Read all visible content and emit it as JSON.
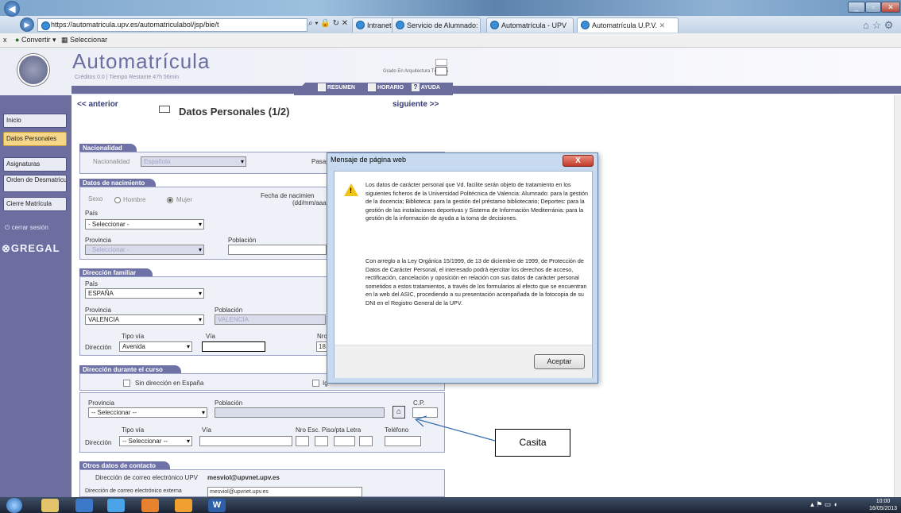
{
  "browser": {
    "address": "https://automatricula.upv.es/automatriculabol/jsp/bie/t",
    "tabs": [
      "Intranet UPV",
      "Servicio de Alumnado: ...",
      "Automatrícula - UPV",
      "Automatrícula U.P.V."
    ],
    "fav_convert": "Convertir",
    "fav_select": "Seleccionar",
    "close_x": "x"
  },
  "app": {
    "title": "Automatrícula",
    "credits": "Créditos 0.0 | Tiempo Restante 47h 56min",
    "degree": "Grado En Arquitectura Técnica",
    "resumen": "RESUMEN",
    "horario": "HORARIO",
    "ayuda": "AYUDA"
  },
  "sidebar": {
    "items": [
      "Inicio",
      "Datos Personales",
      "Asignaturas",
      "Orden de Desmatriculación",
      "Cierre Matrícula"
    ],
    "logout": "cerrar sesión",
    "brand": "GREGAL"
  },
  "page": {
    "prev": "<< anterior",
    "title": "Datos Personales (1/2)",
    "next": "siguiente >>"
  },
  "nacionalidad": {
    "header": "Nacionalidad",
    "label": "Nacionalidad",
    "value": "Española",
    "pasap": "Pasap"
  },
  "nacimiento": {
    "header": "Datos de nacimiento",
    "sexo": "Sexo",
    "hombre": "Hombre",
    "mujer": "Mujer",
    "fecha": "Fecha de nacimien",
    "fecha_fmt": "(dd/mm/aaa",
    "pais": "País",
    "pais_val": "- Seleccionar -",
    "provincia": "Provincia",
    "provincia_val": "- Seleccionar -",
    "poblacion": "Población"
  },
  "familiar": {
    "header": "Dirección familiar",
    "pais": "País",
    "pais_val": "ESPAÑA",
    "provincia": "Provincia",
    "provincia_val": "VALENCIA",
    "poblacion": "Población",
    "poblacion_val": "VALENCIA",
    "tipo_via": "Tipo vía",
    "via": "Vía",
    "nro": "Nro",
    "direccion": "Dirección",
    "tipo_val": "Avenida",
    "nro_val": "18"
  },
  "curso": {
    "header": "Dirección durante el curso",
    "sin_dir": "Sin dirección en España",
    "ig": "Ig",
    "provincia": "Provincia",
    "provincia_val": "-- Seleccionar --",
    "poblacion": "Población",
    "cp": "C.P.",
    "tipo_via": "Tipo vía",
    "via": "Vía",
    "nro_cols": "Nro  Esc. Piso/pta Letra",
    "telefono": "Teléfono",
    "direccion": "Dirección",
    "tipo_val": "-- Seleccionar --"
  },
  "contacto": {
    "header": "Otros datos de contacto",
    "email_label": "Dirección de correo electrónico UPV",
    "email": "mesviol@upvnet.upv.es",
    "ext_label": "Dirección de correo electrónico externa",
    "ext_val": "mesviol@upvnet.upv.es"
  },
  "dialog": {
    "title": "Mensaje de página web",
    "p1": "Los datos de carácter personal que Vd. facilite serán objeto de tratamiento en los siguientes ficheros de la Universidad Politécnica de Valencia: Alumnado: para la gestión de la docencia; Biblioteca: para la gestión del préstamo bibliotecario; Deportes: para la gestión de las instalaciones deportivas y Sistema de Información Mediterránia: para la gestión de la información de ayuda a la toma de decisiones.",
    "p2": "Con arreglo a la Ley Orgánica 15/1999, de 13 de diciembre de 1999, de Protección de Datos de Carácter Personal, el interesado podrá ejercitar los derechos de acceso, rectificación, cancelación y oposición en relación con sus datos de carácter personal sometidos a estos tratamientos, a través de los formularios al efecto que se encuentran en la web del ASIC, procediendo a su presentación acompañada de la fotocopia de su DNI en el Registro General de la UPV.",
    "ok": "Aceptar",
    "close": "X"
  },
  "annotation": "Casita",
  "taskbar": {
    "time": "10:00",
    "date": "16/05/2013"
  }
}
